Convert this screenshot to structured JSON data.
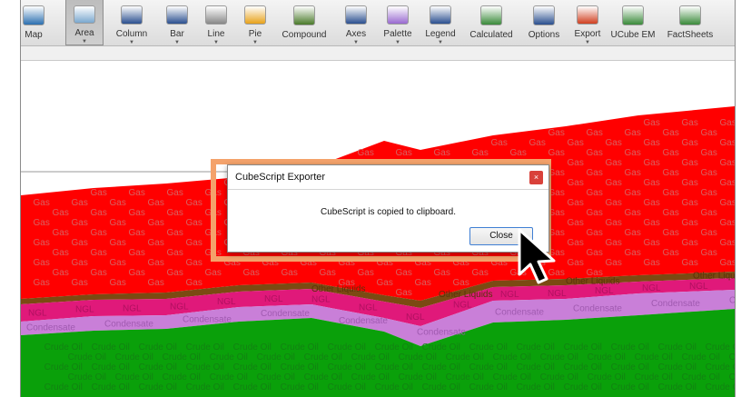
{
  "toolbar": {
    "items": [
      {
        "label": "Map",
        "icon": "globe-icon",
        "has_menu": false
      },
      {
        "label": "Area",
        "icon": "area-chart-icon",
        "has_menu": true,
        "active": true
      },
      {
        "label": "Column",
        "icon": "column-chart-icon",
        "has_menu": true
      },
      {
        "label": "Bar",
        "icon": "bar-chart-icon",
        "has_menu": true
      },
      {
        "label": "Line",
        "icon": "line-chart-icon",
        "has_menu": true
      },
      {
        "label": "Pie",
        "icon": "pie-chart-icon",
        "has_menu": true
      },
      {
        "label": "Compound",
        "icon": "compound-chart-icon",
        "has_menu": false
      },
      {
        "label": "Axes",
        "icon": "axes-icon",
        "has_menu": true
      },
      {
        "label": "Palette",
        "icon": "palette-icon",
        "has_menu": true
      },
      {
        "label": "Legend",
        "icon": "legend-icon",
        "has_menu": true
      },
      {
        "label": "Calculated",
        "icon": "calculated-icon",
        "has_menu": false
      },
      {
        "label": "Options",
        "icon": "options-icon",
        "has_menu": false
      },
      {
        "label": "Export",
        "icon": "export-icon",
        "has_menu": true
      },
      {
        "label": "UCube EM",
        "icon": "ucube-em-icon",
        "has_menu": false
      },
      {
        "label": "FactSheets",
        "icon": "factsheets-icon",
        "has_menu": false
      }
    ]
  },
  "chart": {
    "series_labels": {
      "gas": "Gas",
      "other_liquids": "Other Liquids",
      "ngl": "NGL",
      "condensate": "Condensate",
      "crude_oil": "Crude Oil"
    },
    "colors": {
      "gas": "#ff0000",
      "other_liquids": "#7b4a12",
      "ngl": "#e0197a",
      "condensate": "#c97fd8",
      "crude_oil": "#0aa00a"
    }
  },
  "dialog": {
    "title": "CubeScript Exporter",
    "close_icon": "×",
    "message": "CubeScript is copied to clipboard.",
    "button": "Close"
  }
}
